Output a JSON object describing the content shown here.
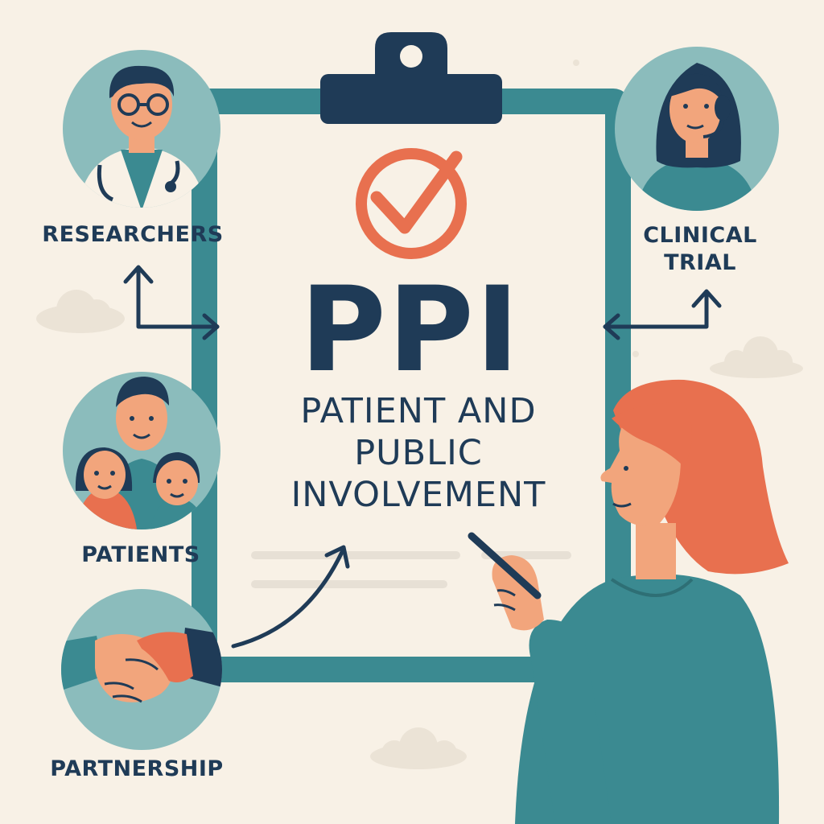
{
  "center": {
    "acronym": "PPI",
    "subtitle_line1": "PATIENT AND",
    "subtitle_line2": "PUBLIC",
    "subtitle_line3": "INVOLVEMENT"
  },
  "nodes": {
    "researchers": "RESEARCHERS",
    "clinical_line1": "CLINICAL",
    "clinical_line2": "TRIAL",
    "patients": "PATIENTS",
    "partnership": "PARTNERSHIP"
  },
  "colors": {
    "background": "#f8f1e6",
    "navy": "#1f3b57",
    "teal": "#3b8a91",
    "circle_teal": "#8bbcbc",
    "orange": "#e8704f",
    "paper": "#f8f1e6"
  },
  "icons": [
    "checkmark-circle-icon",
    "doctor-avatar",
    "headset-avatar",
    "family-avatar",
    "handshake-icon",
    "pen-icon"
  ]
}
